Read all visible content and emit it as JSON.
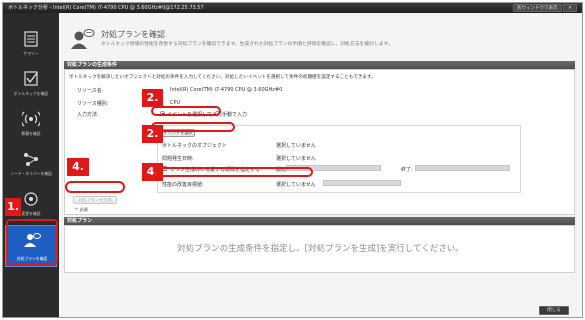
{
  "window": {
    "title": "ボトルネック分析 - Intel(R) Core(TM) i7-4790 CPU @ 3.60GHz#0@172.25.73.57",
    "separate_window_label": "別ウィンドウで表示",
    "close_button_label": "閉じる"
  },
  "sidebar": {
    "items": [
      {
        "label": "サマリー",
        "icon": "list-icon"
      },
      {
        "label": "ボトルネックを確認",
        "icon": "checkbox-icon"
      },
      {
        "label": "影響を確認",
        "icon": "signal-icon"
      },
      {
        "label": "ノード・ネイバーを確認",
        "icon": "network-icon"
      },
      {
        "label": "変更を確認",
        "icon": "compare-icon"
      },
      {
        "label": "対処プランを確認",
        "icon": "user-plan-icon",
        "active": true
      }
    ]
  },
  "header": {
    "title": "対処プランを確認",
    "description": "ボトルネック現場の性能を改善する対処プランを確認できます。生成された対処プランの手順と評価を確認し、対処方法を検討します。"
  },
  "conditions": {
    "section_title": "対処プランの生成条件",
    "instruction": "ボトルネックを解決したいオブジェクトと対処の条件を入力してください。対処したいイベントを選択して条件の初期値を設定することもできます。",
    "resource_label": "リソース名:",
    "resource_value": "Intel(R) Core(TM) i7-4790 CPU @ 3.60GHz#0",
    "resource_type_label": "リソース種別:",
    "resource_type_value": "CPU",
    "input_method_label": "入力方法:",
    "radio_select_event": "イベントを選択して入力",
    "radio_manual": "手動で入力",
    "select_event_button": "イベントを選択",
    "bottleneck_object_label": "ボトルネックのオブジェクト",
    "bottleneck_object_value": "選択していません",
    "problem_time_label": "問題発生日時:",
    "problem_time_value": "選択していません",
    "specify_period_label": "プラン生成時に考慮する期間を指定する:",
    "start_label": "開始:",
    "end_label": "終了:",
    "perf_target_label": "性能の改善目標値:",
    "perf_target_value": "選択していません",
    "generate_button": "対処プランを生成",
    "required_note": "*: 必須"
  },
  "plans": {
    "section_title": "対処プラン",
    "empty_message": "対処プランの生成条件を指定し、[対処プランを生成]を実行してください。"
  },
  "callouts": {
    "step1": "1.",
    "step2a": "2.",
    "step2b": "2.",
    "step4a": "4.",
    "step4b": "4."
  },
  "colors": {
    "accent": "#1f5fc4",
    "callout": "#e01818",
    "sidebar": "#2b2b2b"
  }
}
